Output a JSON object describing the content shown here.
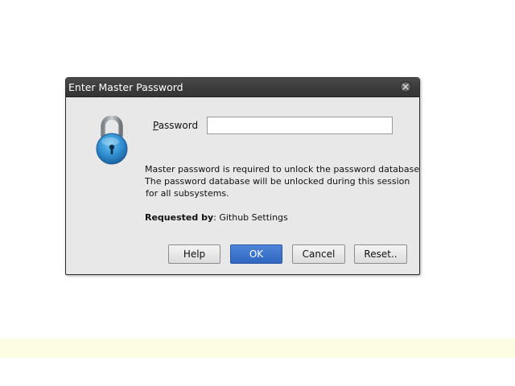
{
  "dialog": {
    "title": "Enter Master Password",
    "close_icon": "close-icon",
    "lock_icon": "padlock-icon",
    "password_label_mnemonic": "P",
    "password_label_rest": "assword",
    "password_value": "",
    "message_lines": [
      "Master password is required to unlock the password database.",
      "The password database will be unlocked during this session",
      "for all subsystems."
    ],
    "requested_by_label": "Requested by",
    "requested_by_value": ": Github Settings",
    "buttons": {
      "help": "Help",
      "ok": "OK",
      "cancel": "Cancel",
      "reset": "Reset.."
    }
  },
  "colors": {
    "titlebar": "#3c3c3c",
    "dialog_bg": "#e8e8e8",
    "ok_button": "#3a72cc",
    "lock_blue": "#2f8ed0",
    "bottom_strip": "#fdfde3"
  }
}
